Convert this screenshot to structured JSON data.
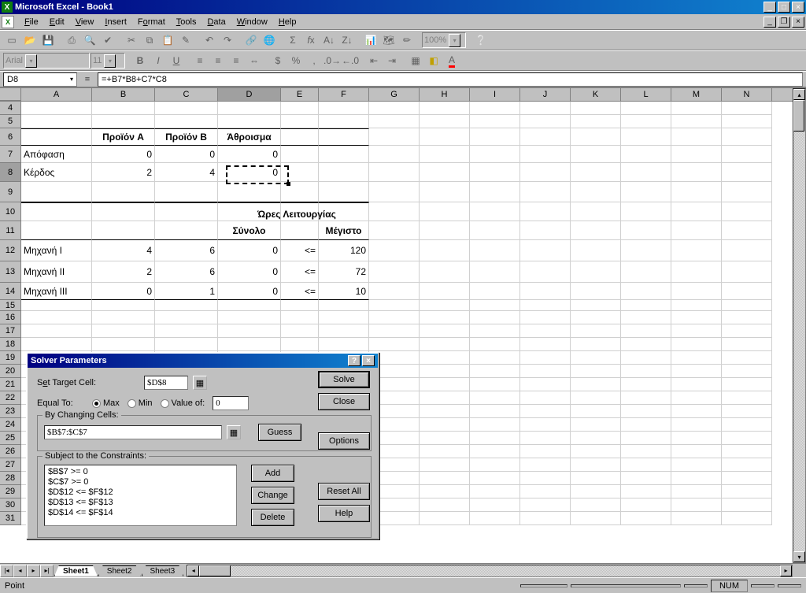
{
  "titlebar": {
    "text": "Microsoft Excel - Book1"
  },
  "menu": {
    "file": "File",
    "edit": "Edit",
    "view": "View",
    "insert": "Insert",
    "format": "Format",
    "tools": "Tools",
    "data": "Data",
    "window": "Window",
    "help": "Help"
  },
  "formatting": {
    "font": "Arial",
    "size": "11",
    "zoom": "100%"
  },
  "namebox": "D8",
  "formula_eq": "=",
  "formula": "=+B7*B8+C7*C8",
  "columns": [
    "A",
    "B",
    "C",
    "D",
    "E",
    "F",
    "G",
    "H",
    "I",
    "J",
    "K",
    "L",
    "M",
    "N"
  ],
  "rows_visible_start": 4,
  "cells": {
    "B6": "Προϊόν A",
    "C6": "Προϊόν B",
    "D6": "Άθροισμα",
    "A7": "Απόφαση",
    "B7": "0",
    "C7": "0",
    "D7": "0",
    "A8": "Κέρδος",
    "B8": "2",
    "C8": "4",
    "D8": "0",
    "D10E10": "Ώρες Λειτουργίας",
    "D11": "Σύνολο",
    "F11": "Μέγιστο",
    "A12": "Μηχανή I",
    "B12": "4",
    "C12": "6",
    "D12": "0",
    "E12": "<=",
    "F12": "120",
    "A13": "Μηχανή II",
    "B13": "2",
    "C13": "6",
    "D13": "0",
    "E13": "<=",
    "F13": "72",
    "A14": "Μηχανή III",
    "B14": "0",
    "C14": "1",
    "D14": "0",
    "E14": "<=",
    "F14": "10"
  },
  "tabs": [
    "Sheet1",
    "Sheet2",
    "Sheet3"
  ],
  "status": {
    "mode": "Point",
    "num": "NUM"
  },
  "dialog": {
    "title": "Solver Parameters",
    "settarget_label": "Set Target Cell:",
    "settarget_value": "$D$8",
    "equalto_label": "Equal To:",
    "opt_max": "Max",
    "opt_min": "Min",
    "opt_value": "Value of:",
    "value_of": "0",
    "bychanging_label": "By Changing Cells:",
    "bychanging_value": "$B$7:$C$7",
    "guess": "Guess",
    "subject_label": "Subject to the Constraints:",
    "constraints": [
      "$B$7 >= 0",
      "$C$7 >= 0",
      "$D$12 <= $F$12",
      "$D$13 <= $F$13",
      "$D$14 <= $F$14"
    ],
    "add": "Add",
    "change": "Change",
    "delete": "Delete",
    "solve": "Solve",
    "close": "Close",
    "options": "Options",
    "resetall": "Reset All",
    "help": "Help"
  }
}
